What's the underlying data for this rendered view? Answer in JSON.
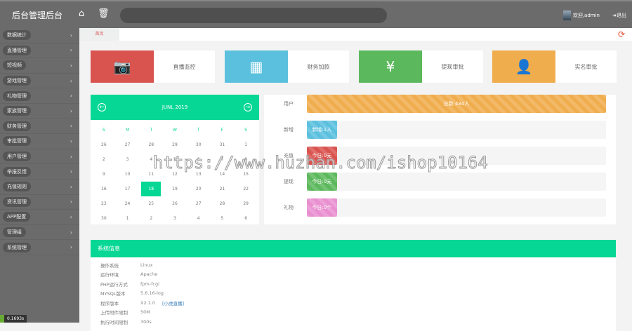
{
  "header": {
    "title": "后台管理后台",
    "home_icon": "home-icon",
    "trash_icon": "trash-icon",
    "welcome": "欢迎,admin",
    "logout": "退出"
  },
  "sidebar": {
    "items": [
      {
        "label": "数据统计"
      },
      {
        "label": "直播管理"
      },
      {
        "label": "短视频"
      },
      {
        "label": "游戏管理"
      },
      {
        "label": "礼物管理"
      },
      {
        "label": "家族管理"
      },
      {
        "label": "财务管理"
      },
      {
        "label": "审批管理"
      },
      {
        "label": "用户管理"
      },
      {
        "label": "举报反馈"
      },
      {
        "label": "充值规则"
      },
      {
        "label": "资讯管理"
      },
      {
        "label": "APP配置"
      },
      {
        "label": "管理组"
      },
      {
        "label": "系统管理"
      }
    ]
  },
  "tabs": {
    "home": "首页"
  },
  "cards": [
    {
      "label": "直播监控",
      "icon": "camera-icon",
      "color": "#d9534f"
    },
    {
      "label": "财务加款",
      "icon": "grid-icon",
      "color": "#5bc0de"
    },
    {
      "label": "提现审批",
      "icon": "yen-icon",
      "color": "#5cb85c"
    },
    {
      "label": "实名审批",
      "icon": "user-icon",
      "color": "#f0ad4e"
    }
  ],
  "calendar": {
    "month": "JUNL 2019",
    "weekdays": [
      "S",
      "M",
      "T",
      "W",
      "T",
      "F",
      "S"
    ],
    "days": [
      "26",
      "27",
      "28",
      "29",
      "30",
      "31",
      "1",
      "2",
      "3",
      "4",
      "5",
      "6",
      "7",
      "8",
      "9",
      "10",
      "11",
      "12",
      "13",
      "14",
      "15",
      "16",
      "17",
      "18",
      "19",
      "20",
      "21",
      "22",
      "23",
      "24",
      "25",
      "26",
      "27",
      "28",
      "29",
      "30",
      "1",
      "2",
      "3",
      "4",
      "5",
      "6"
    ],
    "selected": "18"
  },
  "stats": [
    {
      "label": "用户",
      "text": "总数:434人",
      "percent": 100,
      "color": "#f0ad4e"
    },
    {
      "label": "新增",
      "text": "新增:1人",
      "percent": 10,
      "color": "#5bc0de"
    },
    {
      "label": "充值",
      "text": "今日:0元",
      "percent": 10,
      "color": "#d9534f"
    },
    {
      "label": "提现",
      "text": "今日:0元",
      "percent": 10,
      "color": "#5cb85c"
    },
    {
      "label": "礼物",
      "text": "今日:0个",
      "percent": 10,
      "color": "#e98fd0"
    }
  ],
  "system": {
    "title": "系统信息",
    "rows": [
      {
        "k": "操作系统",
        "v": "Linux"
      },
      {
        "k": "运行环境",
        "v": "Apache"
      },
      {
        "k": "PHP运行方式",
        "v": "fpm-fcgi"
      },
      {
        "k": "MYSQL版本",
        "v": "5.6.16-log"
      },
      {
        "k": "程序版本",
        "v": "X2.1.0",
        "link": "[小虎直播]"
      },
      {
        "k": "上传附件限制",
        "v": "50M"
      },
      {
        "k": "执行时间限制",
        "v": "300s"
      }
    ]
  },
  "timer": "0.1693s",
  "watermark": "https://www.huzhan.com/ishop10164"
}
